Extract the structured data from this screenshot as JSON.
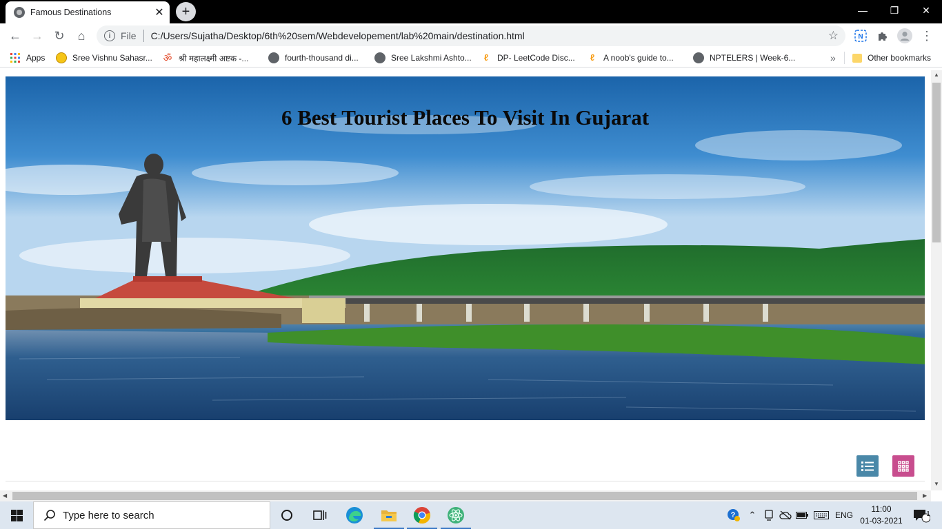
{
  "browser": {
    "tab_title": "Famous Destinations",
    "omnibox": {
      "scheme_label": "File",
      "url": "C:/Users/Sujatha/Desktop/6th%20sem/Webdevelopement/lab%20main/destination.html"
    },
    "bookmarks": [
      {
        "label": "Apps"
      },
      {
        "label": "Sree Vishnu Sahasr..."
      },
      {
        "label": "श्री महालक्ष्मी अष्टक -..."
      },
      {
        "label": "fourth-thousand di..."
      },
      {
        "label": "Sree Lakshmi Ashto..."
      },
      {
        "label": "DP- LeetCode Disc..."
      },
      {
        "label": "A noob's guide to..."
      },
      {
        "label": "NPTELERS | Week-6..."
      }
    ],
    "bookmarks_overflow": "»",
    "other_bookmarks": "Other bookmarks"
  },
  "page": {
    "hero_title": "6 Best Tourist Places To Visit In Gujarat",
    "list_view_color": "#4a88a8",
    "grid_view_color": "#c84d8e"
  },
  "taskbar": {
    "search_placeholder": "Type here to search",
    "language": "ENG",
    "time": "11:00",
    "date": "01-03-2021",
    "notification_count": "1"
  }
}
